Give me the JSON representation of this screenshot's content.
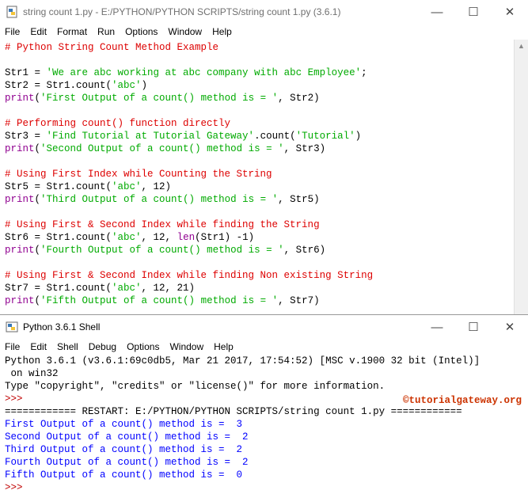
{
  "editor": {
    "title": "string count 1.py - E:/PYTHON/PYTHON SCRIPTS/string count 1.py (3.6.1)",
    "menu": [
      "File",
      "Edit",
      "Format",
      "Run",
      "Options",
      "Window",
      "Help"
    ],
    "lines": [
      [
        {
          "t": "# Python String Count Method Example",
          "c": "comment"
        }
      ],
      [
        {
          "t": "",
          "c": "plain"
        }
      ],
      [
        {
          "t": "Str1 = ",
          "c": "plain"
        },
        {
          "t": "'We are abc working at abc company with abc Employee'",
          "c": "str"
        },
        {
          "t": ";",
          "c": "plain"
        }
      ],
      [
        {
          "t": "Str2 = Str1.count(",
          "c": "plain"
        },
        {
          "t": "'abc'",
          "c": "str"
        },
        {
          "t": ")",
          "c": "plain"
        }
      ],
      [
        {
          "t": "print",
          "c": "builtin"
        },
        {
          "t": "(",
          "c": "plain"
        },
        {
          "t": "'First Output of a count() method is = '",
          "c": "str"
        },
        {
          "t": ", Str2)",
          "c": "plain"
        }
      ],
      [
        {
          "t": "",
          "c": "plain"
        }
      ],
      [
        {
          "t": "# Performing count() function directly",
          "c": "comment"
        }
      ],
      [
        {
          "t": "Str3 = ",
          "c": "plain"
        },
        {
          "t": "'Find Tutorial at Tutorial Gateway'",
          "c": "str"
        },
        {
          "t": ".count(",
          "c": "plain"
        },
        {
          "t": "'Tutorial'",
          "c": "str"
        },
        {
          "t": ")",
          "c": "plain"
        }
      ],
      [
        {
          "t": "print",
          "c": "builtin"
        },
        {
          "t": "(",
          "c": "plain"
        },
        {
          "t": "'Second Output of a count() method is = '",
          "c": "str"
        },
        {
          "t": ", Str3)",
          "c": "plain"
        }
      ],
      [
        {
          "t": "",
          "c": "plain"
        }
      ],
      [
        {
          "t": "# Using First Index while Counting the String",
          "c": "comment"
        }
      ],
      [
        {
          "t": "Str5 = Str1.count(",
          "c": "plain"
        },
        {
          "t": "'abc'",
          "c": "str"
        },
        {
          "t": ", 12)",
          "c": "plain"
        }
      ],
      [
        {
          "t": "print",
          "c": "builtin"
        },
        {
          "t": "(",
          "c": "plain"
        },
        {
          "t": "'Third Output of a count() method is = '",
          "c": "str"
        },
        {
          "t": ", Str5)",
          "c": "plain"
        }
      ],
      [
        {
          "t": "",
          "c": "plain"
        }
      ],
      [
        {
          "t": "# Using First & Second Index while finding the String",
          "c": "comment"
        }
      ],
      [
        {
          "t": "Str6 = Str1.count(",
          "c": "plain"
        },
        {
          "t": "'abc'",
          "c": "str"
        },
        {
          "t": ", 12, ",
          "c": "plain"
        },
        {
          "t": "len",
          "c": "builtin"
        },
        {
          "t": "(Str1) -1)",
          "c": "plain"
        }
      ],
      [
        {
          "t": "print",
          "c": "builtin"
        },
        {
          "t": "(",
          "c": "plain"
        },
        {
          "t": "'Fourth Output of a count() method is = '",
          "c": "str"
        },
        {
          "t": ", Str6)",
          "c": "plain"
        }
      ],
      [
        {
          "t": "",
          "c": "plain"
        }
      ],
      [
        {
          "t": "# Using First & Second Index while finding Non existing String",
          "c": "comment"
        }
      ],
      [
        {
          "t": "Str7 = Str1.count(",
          "c": "plain"
        },
        {
          "t": "'abc'",
          "c": "str"
        },
        {
          "t": ", 12, 21)",
          "c": "plain"
        }
      ],
      [
        {
          "t": "print",
          "c": "builtin"
        },
        {
          "t": "(",
          "c": "plain"
        },
        {
          "t": "'Fifth Output of a count() method is = '",
          "c": "str"
        },
        {
          "t": ", Str7)",
          "c": "plain"
        }
      ]
    ]
  },
  "shell": {
    "title": "Python 3.6.1 Shell",
    "menu": [
      "File",
      "Edit",
      "Shell",
      "Debug",
      "Options",
      "Window",
      "Help"
    ],
    "watermark": "©tutorialgateway.org",
    "lines": [
      [
        {
          "t": "Python 3.6.1 (v3.6.1:69c0db5, Mar 21 2017, 17:54:52) [MSC v.1900 32 bit (Intel)]",
          "c": "plain"
        }
      ],
      [
        {
          "t": " on win32",
          "c": "plain"
        }
      ],
      [
        {
          "t": "Type \"copyright\", \"credits\" or \"license()\" for more information.",
          "c": "plain"
        }
      ],
      [
        {
          "t": ">>> ",
          "c": "red"
        }
      ],
      [
        {
          "t": "============ RESTART: E:/PYTHON/PYTHON SCRIPTS/string count 1.py ============",
          "c": "plain"
        }
      ],
      [
        {
          "t": "First Output of a count() method is =  3",
          "c": "blue"
        }
      ],
      [
        {
          "t": "Second Output of a count() method is =  2",
          "c": "blue"
        }
      ],
      [
        {
          "t": "Third Output of a count() method is =  2",
          "c": "blue"
        }
      ],
      [
        {
          "t": "Fourth Output of a count() method is =  2",
          "c": "blue"
        }
      ],
      [
        {
          "t": "Fifth Output of a count() method is =  0",
          "c": "blue"
        }
      ],
      [
        {
          "t": ">>> ",
          "c": "red"
        }
      ]
    ]
  },
  "colors": {
    "comment": "#dd0000",
    "string": "#00aa00",
    "builtin": "#900090",
    "output": "#0000ff",
    "prompt": "#c00000"
  }
}
